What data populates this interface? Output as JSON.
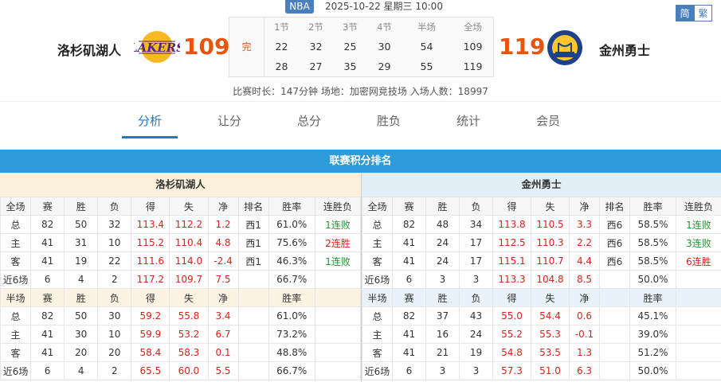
{
  "header": {
    "league": "NBA",
    "datetime": "2025-10-22 星期三 10:00",
    "lang": {
      "simplified": "简",
      "traditional": "繁"
    },
    "home": {
      "name": "洛杉矶湖人",
      "score": "109"
    },
    "away": {
      "name": "金州勇士",
      "score": "119"
    },
    "status": "完",
    "quarters": {
      "headers": [
        "1节",
        "2节",
        "3节",
        "4节",
        "半场",
        "全场"
      ],
      "home": [
        "22",
        "32",
        "25",
        "30",
        "54",
        "109"
      ],
      "away": [
        "28",
        "27",
        "35",
        "29",
        "55",
        "119"
      ]
    },
    "meta": "比赛时长：147分钟  场地：加密网竞技场  入场人数：18997"
  },
  "tabs": [
    "分析",
    "让分",
    "总分",
    "胜负",
    "统计",
    "会员"
  ],
  "section_title": "联赛积分排名",
  "colors": {
    "accent": "#2178c6",
    "score": "#e8540d",
    "section": "#2d9ad9",
    "win": "#d9231b",
    "lose": "#1f9a2e"
  },
  "standings": {
    "home": {
      "team": "洛杉矶湖人",
      "full_headers": [
        "全场",
        "赛",
        "胜",
        "负",
        "得",
        "失",
        "净",
        "排名",
        "胜率",
        "连胜负"
      ],
      "full_rows": [
        [
          "总",
          "82",
          "50",
          "32",
          "113.4",
          "112.2",
          "1.2",
          "西1",
          "61.0%",
          "1连败"
        ],
        [
          "主",
          "41",
          "31",
          "10",
          "115.2",
          "110.4",
          "4.8",
          "西1",
          "75.6%",
          "2连胜"
        ],
        [
          "客",
          "41",
          "19",
          "22",
          "111.6",
          "114.0",
          "-2.4",
          "西1",
          "46.3%",
          "1连败"
        ],
        [
          "近6场",
          "6",
          "4",
          "2",
          "117.2",
          "109.7",
          "7.5",
          "",
          "66.7%",
          ""
        ]
      ],
      "half_headers": [
        "半场",
        "赛",
        "胜",
        "负",
        "得",
        "失",
        "净",
        "",
        "胜率",
        ""
      ],
      "half_rows": [
        [
          "总",
          "82",
          "50",
          "30",
          "59.2",
          "55.8",
          "3.4",
          "",
          "61.0%",
          ""
        ],
        [
          "主",
          "41",
          "30",
          "10",
          "59.9",
          "53.2",
          "6.7",
          "",
          "73.2%",
          ""
        ],
        [
          "客",
          "41",
          "20",
          "20",
          "58.4",
          "58.3",
          "0.1",
          "",
          "48.8%",
          ""
        ],
        [
          "近6场",
          "6",
          "4",
          "2",
          "65.5",
          "60.0",
          "5.5",
          "",
          "66.7%",
          ""
        ]
      ]
    },
    "away": {
      "team": "金州勇士",
      "full_headers": [
        "全场",
        "赛",
        "胜",
        "负",
        "得",
        "失",
        "净",
        "排名",
        "胜率",
        "连胜负"
      ],
      "full_rows": [
        [
          "总",
          "82",
          "48",
          "34",
          "113.8",
          "110.5",
          "3.3",
          "西6",
          "58.5%",
          "1连败"
        ],
        [
          "主",
          "41",
          "24",
          "17",
          "112.5",
          "110.3",
          "2.2",
          "西6",
          "58.5%",
          "3连败"
        ],
        [
          "客",
          "41",
          "24",
          "17",
          "115.1",
          "110.7",
          "4.4",
          "西6",
          "58.5%",
          "6连胜"
        ],
        [
          "近6场",
          "6",
          "3",
          "3",
          "113.3",
          "104.8",
          "8.5",
          "",
          "50.0%",
          ""
        ]
      ],
      "half_headers": [
        "半场",
        "赛",
        "胜",
        "负",
        "得",
        "失",
        "净",
        "",
        "胜率",
        ""
      ],
      "half_rows": [
        [
          "总",
          "82",
          "37",
          "43",
          "55.0",
          "54.4",
          "0.6",
          "",
          "45.1%",
          ""
        ],
        [
          "主",
          "41",
          "16",
          "24",
          "55.2",
          "55.3",
          "-0.1",
          "",
          "39.0%",
          ""
        ],
        [
          "客",
          "41",
          "21",
          "19",
          "54.8",
          "53.5",
          "1.3",
          "",
          "51.2%",
          ""
        ],
        [
          "近6场",
          "6",
          "3",
          "3",
          "57.3",
          "51.0",
          "6.3",
          "",
          "50.0%",
          ""
        ]
      ]
    }
  }
}
